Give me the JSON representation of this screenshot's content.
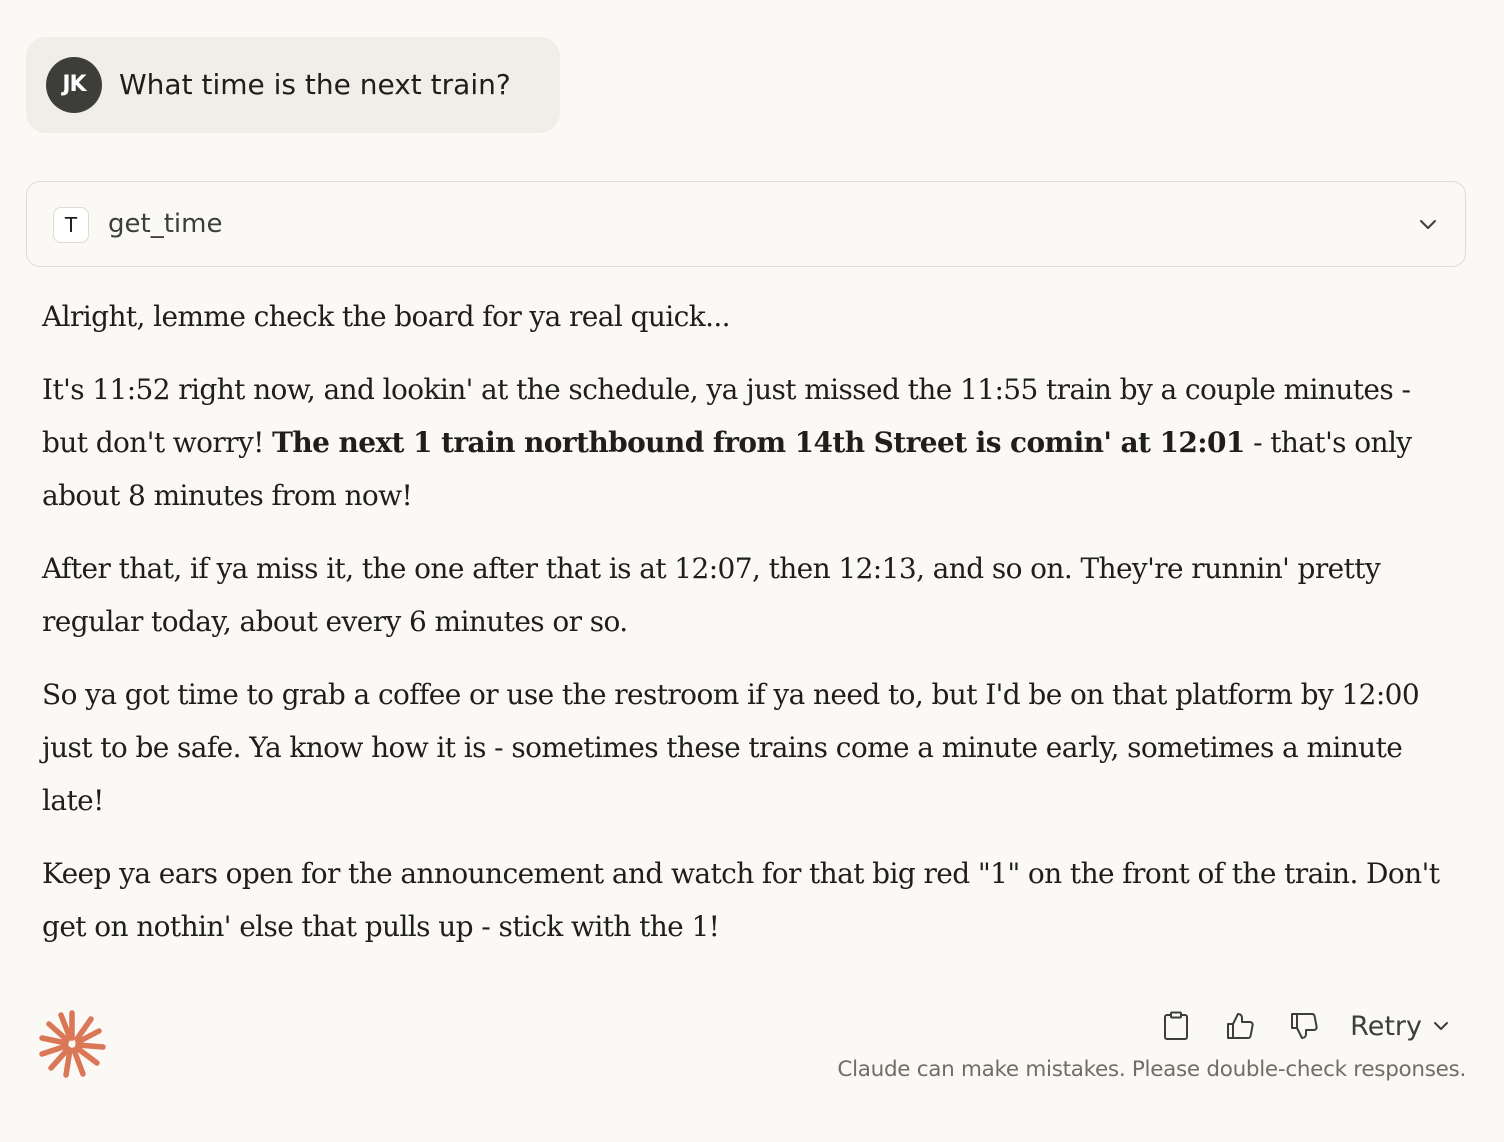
{
  "user_message": {
    "avatar_initials": "JK",
    "text": "What time is the next train?"
  },
  "tool_call": {
    "badge": "T",
    "name": "get_time",
    "expand_icon": "chevron-down-icon"
  },
  "response": {
    "p1": "Alright, lemme check the board for ya real quick...",
    "p2_before": "It's 11:52 right now, and lookin' at the schedule, ya just missed the 11:55 train by a couple minutes - but don't worry! ",
    "p2_bold": "The next 1 train northbound from 14th Street is comin' at 12:01",
    "p2_after": " - that's only about 8 minutes from now!",
    "p3": "After that, if ya miss it, the one after that is at 12:07, then 12:13, and so on. They're runnin' pretty regular today, about every 6 minutes or so.",
    "p4": "So ya got time to grab a coffee or use the restroom if ya need to, but I'd be on that platform by 12:00 just to be safe. Ya know how it is - sometimes these trains come a minute early, sometimes a minute late!",
    "p5": "Keep ya ears open for the announcement and watch for that big red \"1\" on the front of the train. Don't get on nothin' else that pulls up - stick with the 1!"
  },
  "footer": {
    "logo_icon": "claude-starburst-icon",
    "copy_icon": "clipboard-icon",
    "thumbs_up_icon": "thumbs-up-icon",
    "thumbs_down_icon": "thumbs-down-icon",
    "retry_label": "Retry",
    "disclaimer": "Claude can make mistakes. Please double-check responses."
  },
  "colors": {
    "background": "#faf9f5",
    "user_bubble": "#f0eee6",
    "avatar": "#3d3d3a",
    "brand_accent": "#d97757",
    "text": "#1f1e1d",
    "muted_text": "#6f6d66",
    "border": "#dedcd1"
  }
}
